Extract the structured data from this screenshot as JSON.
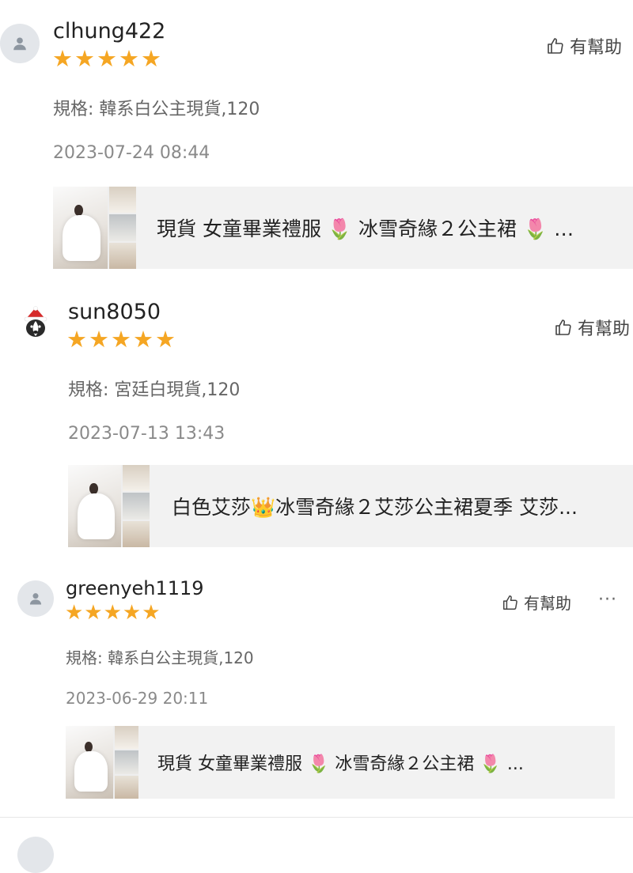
{
  "reviews": [
    {
      "username": "clhung422",
      "stars": "★★★★★",
      "helpful_label": "有幫助",
      "spec": "規格: 韓系白公主現貨,120",
      "date": "2023-07-24 08:44",
      "product_title_a": "現貨 女童畢業禮服",
      "emoji_1": "🌷",
      "product_title_b": "冰雪奇緣２公主裙",
      "emoji_2": "🌷",
      "product_title_c": "…"
    },
    {
      "username": "sun8050",
      "stars": "★★★★★",
      "helpful_label": "有幫助",
      "spec": "規格: 宮廷白現貨,120",
      "date": "2023-07-13 13:43",
      "product_title_a": "白色艾莎",
      "emoji_1": "👑",
      "product_title_b": "冰雪奇緣２艾莎公主裙夏季 艾莎..."
    },
    {
      "username": "greenyeh1119",
      "stars": "★★★★★",
      "helpful_label": "有幫助",
      "more_label": "···",
      "spec": "規格: 韓系白公主現貨,120",
      "date": "2023-06-29 20:11",
      "product_title_a": "現貨 女童畢業禮服",
      "emoji_1": "🌷",
      "product_title_b": "冰雪奇緣２公主裙",
      "emoji_2": "🌷",
      "product_title_c": "..."
    }
  ],
  "colors": {
    "star": "#f5a623",
    "card_bg": "#f2f2f2",
    "muted_text": "#8a8a8a"
  },
  "icons": {
    "avatar_default": "person-silhouette-icon",
    "avatar_custom": "dog-santa-hat-avatar",
    "helpful": "thumbs-up-outline-icon",
    "more": "ellipsis-icon"
  }
}
